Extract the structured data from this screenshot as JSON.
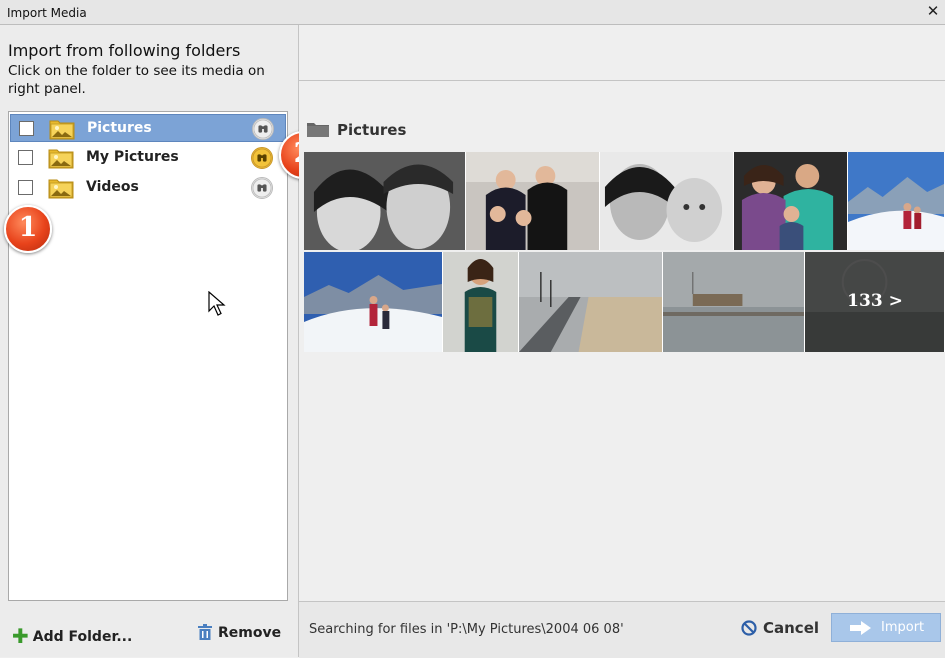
{
  "window": {
    "title": "Import Media",
    "close_glyph": "✕"
  },
  "left_panel": {
    "heading": "Import from following folders",
    "subheading": "Click on the folder to see its media on right panel.",
    "folders": [
      {
        "label": "Pictures",
        "selected": true,
        "checked": false,
        "preview_active": false
      },
      {
        "label": "My Pictures",
        "selected": false,
        "checked": false,
        "preview_active": true
      },
      {
        "label": "Videos",
        "selected": false,
        "checked": false,
        "preview_active": false
      }
    ],
    "add_folder_label": "Add Folder...",
    "remove_label": "Remove"
  },
  "callouts": {
    "one": "1",
    "two": "2"
  },
  "right_panel": {
    "folder_title": "Pictures",
    "more_count": "133 >"
  },
  "footer": {
    "status": "Searching for files in 'P:\\My Pictures\\2004 06 08'",
    "cancel_label": "Cancel",
    "import_label": "Import"
  },
  "colors": {
    "selection": "#7ca3d6",
    "badge": "#e8431b",
    "folder_icon": "#f0c53a",
    "import_button": "#a9c7ea",
    "add_icon": "#3a9a2c"
  }
}
